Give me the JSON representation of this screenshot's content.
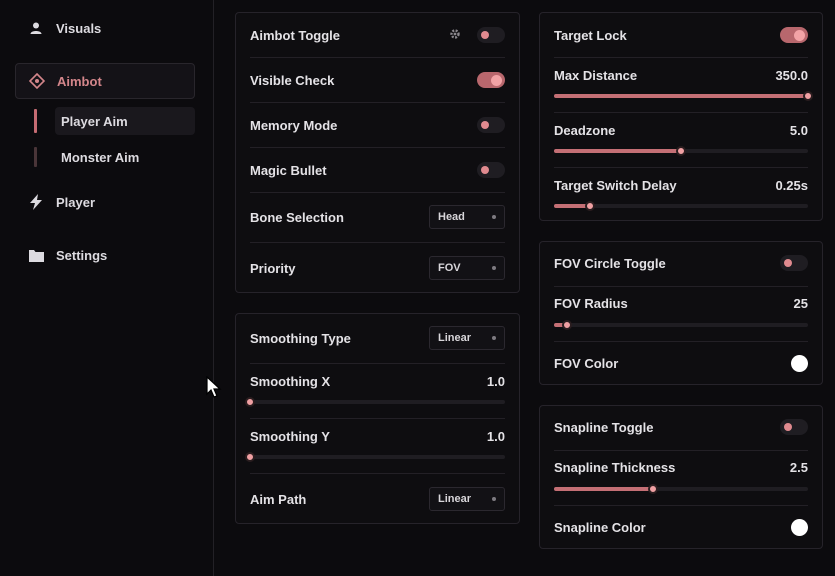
{
  "sidebar": {
    "items": [
      {
        "label": "Visuals",
        "icon": "user-icon"
      },
      {
        "label": "Aimbot",
        "icon": "crosshair-icon"
      },
      {
        "label": "Player",
        "icon": "lightning-icon"
      },
      {
        "label": "Settings",
        "icon": "folder-icon"
      }
    ],
    "subitems": [
      {
        "label": "Player Aim"
      },
      {
        "label": "Monster Aim"
      }
    ]
  },
  "main": {
    "aimbot": {
      "toggle_label": "Aimbot Toggle",
      "toggle_on": false,
      "visible_check_label": "Visible Check",
      "visible_check_on": true,
      "memory_mode_label": "Memory Mode",
      "memory_mode_on": false,
      "magic_bullet_label": "Magic Bullet",
      "magic_bullet_on": false,
      "bone_label": "Bone Selection",
      "bone_value": "Head",
      "priority_label": "Priority",
      "priority_value": "FOV"
    },
    "smoothing": {
      "type_label": "Smoothing Type",
      "type_value": "Linear",
      "x_label": "Smoothing X",
      "x_value": "1.0",
      "x_fraction": 0.0,
      "y_label": "Smoothing Y",
      "y_value": "1.0",
      "y_fraction": 0.0,
      "aim_path_label": "Aim Path",
      "aim_path_value": "Linear"
    },
    "target": {
      "lock_label": "Target Lock",
      "lock_on": true,
      "max_distance_label": "Max Distance",
      "max_distance_value": "350.0",
      "max_distance_fraction": 1.0,
      "deadzone_label": "Deadzone",
      "deadzone_value": "5.0",
      "deadzone_fraction": 0.5,
      "switch_delay_label": "Target Switch Delay",
      "switch_delay_value": "0.25s",
      "switch_delay_fraction": 0.14
    },
    "fov": {
      "toggle_label": "FOV Circle Toggle",
      "toggle_on": false,
      "radius_label": "FOV Radius",
      "radius_value": "25",
      "radius_fraction": 0.05,
      "color_label": "FOV Color",
      "color_value": "#ffffff"
    },
    "snapline": {
      "toggle_label": "Snapline Toggle",
      "toggle_on": false,
      "thickness_label": "Snapline Thickness",
      "thickness_value": "2.5",
      "thickness_fraction": 0.39,
      "color_label": "Snapline Color",
      "color_value": "#ffffff"
    }
  },
  "colors": {
    "accent": "#c46f75",
    "accent_light": "#f0a0a3",
    "background": "#0c0b0e",
    "panel": "#0e0d10"
  }
}
